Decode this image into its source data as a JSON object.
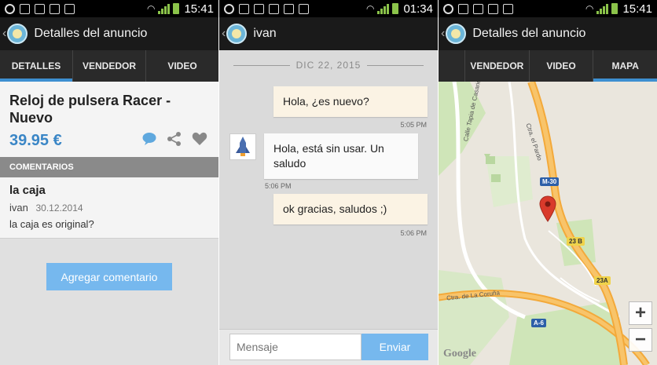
{
  "status_bar": {
    "panel1_time": "15:41",
    "panel2_time": "01:34",
    "panel3_time": "15:41"
  },
  "panel1": {
    "title": "Detalles del anuncio",
    "tabs": [
      {
        "label": "DETALLES",
        "active": true
      },
      {
        "label": "VENDEDOR",
        "active": false
      },
      {
        "label": "VIDEO",
        "active": false
      }
    ],
    "product_title": "Reloj de pulsera Racer - Nuevo",
    "price": "39.95 €",
    "comments_header": "COMENTARIOS",
    "comment": {
      "title": "la caja",
      "author": "ivan",
      "date": "30.12.2014",
      "text": "la caja es original?"
    },
    "add_comment_label": "Agregar comentario"
  },
  "panel2": {
    "title": "ivan",
    "date_separator": "DIC 22, 2015",
    "messages": [
      {
        "text": "Hola, ¿es nuevo?",
        "time": "5:05 PM",
        "direction": "out"
      },
      {
        "text": "Hola, está sin usar. Un saludo",
        "time": "5:06 PM",
        "direction": "in"
      },
      {
        "text": "ok gracias, saludos ;)",
        "time": "5:06 PM",
        "direction": "out"
      }
    ],
    "input_placeholder": "Mensaje",
    "send_label": "Enviar"
  },
  "panel3": {
    "title": "Detalles del anuncio",
    "tabs": [
      {
        "label": "VENDEDOR",
        "active": false
      },
      {
        "label": "VIDEO",
        "active": false
      },
      {
        "label": "MAPA",
        "active": true
      }
    ],
    "map": {
      "labels": [
        "Calle Tapia de Casariego",
        "Ctra. el Pardo",
        "Ctra. de La Coruña",
        "M-30",
        "23 B",
        "23A",
        "A-6"
      ],
      "attribution": "Google",
      "zoom_in": "+",
      "zoom_out": "−"
    }
  },
  "colors": {
    "accent": "#3d8fd1",
    "button": "#76b8ee",
    "price": "#3a86c6",
    "signal": "#8bc34a",
    "outgoing_bubble": "#fbf3e4"
  }
}
